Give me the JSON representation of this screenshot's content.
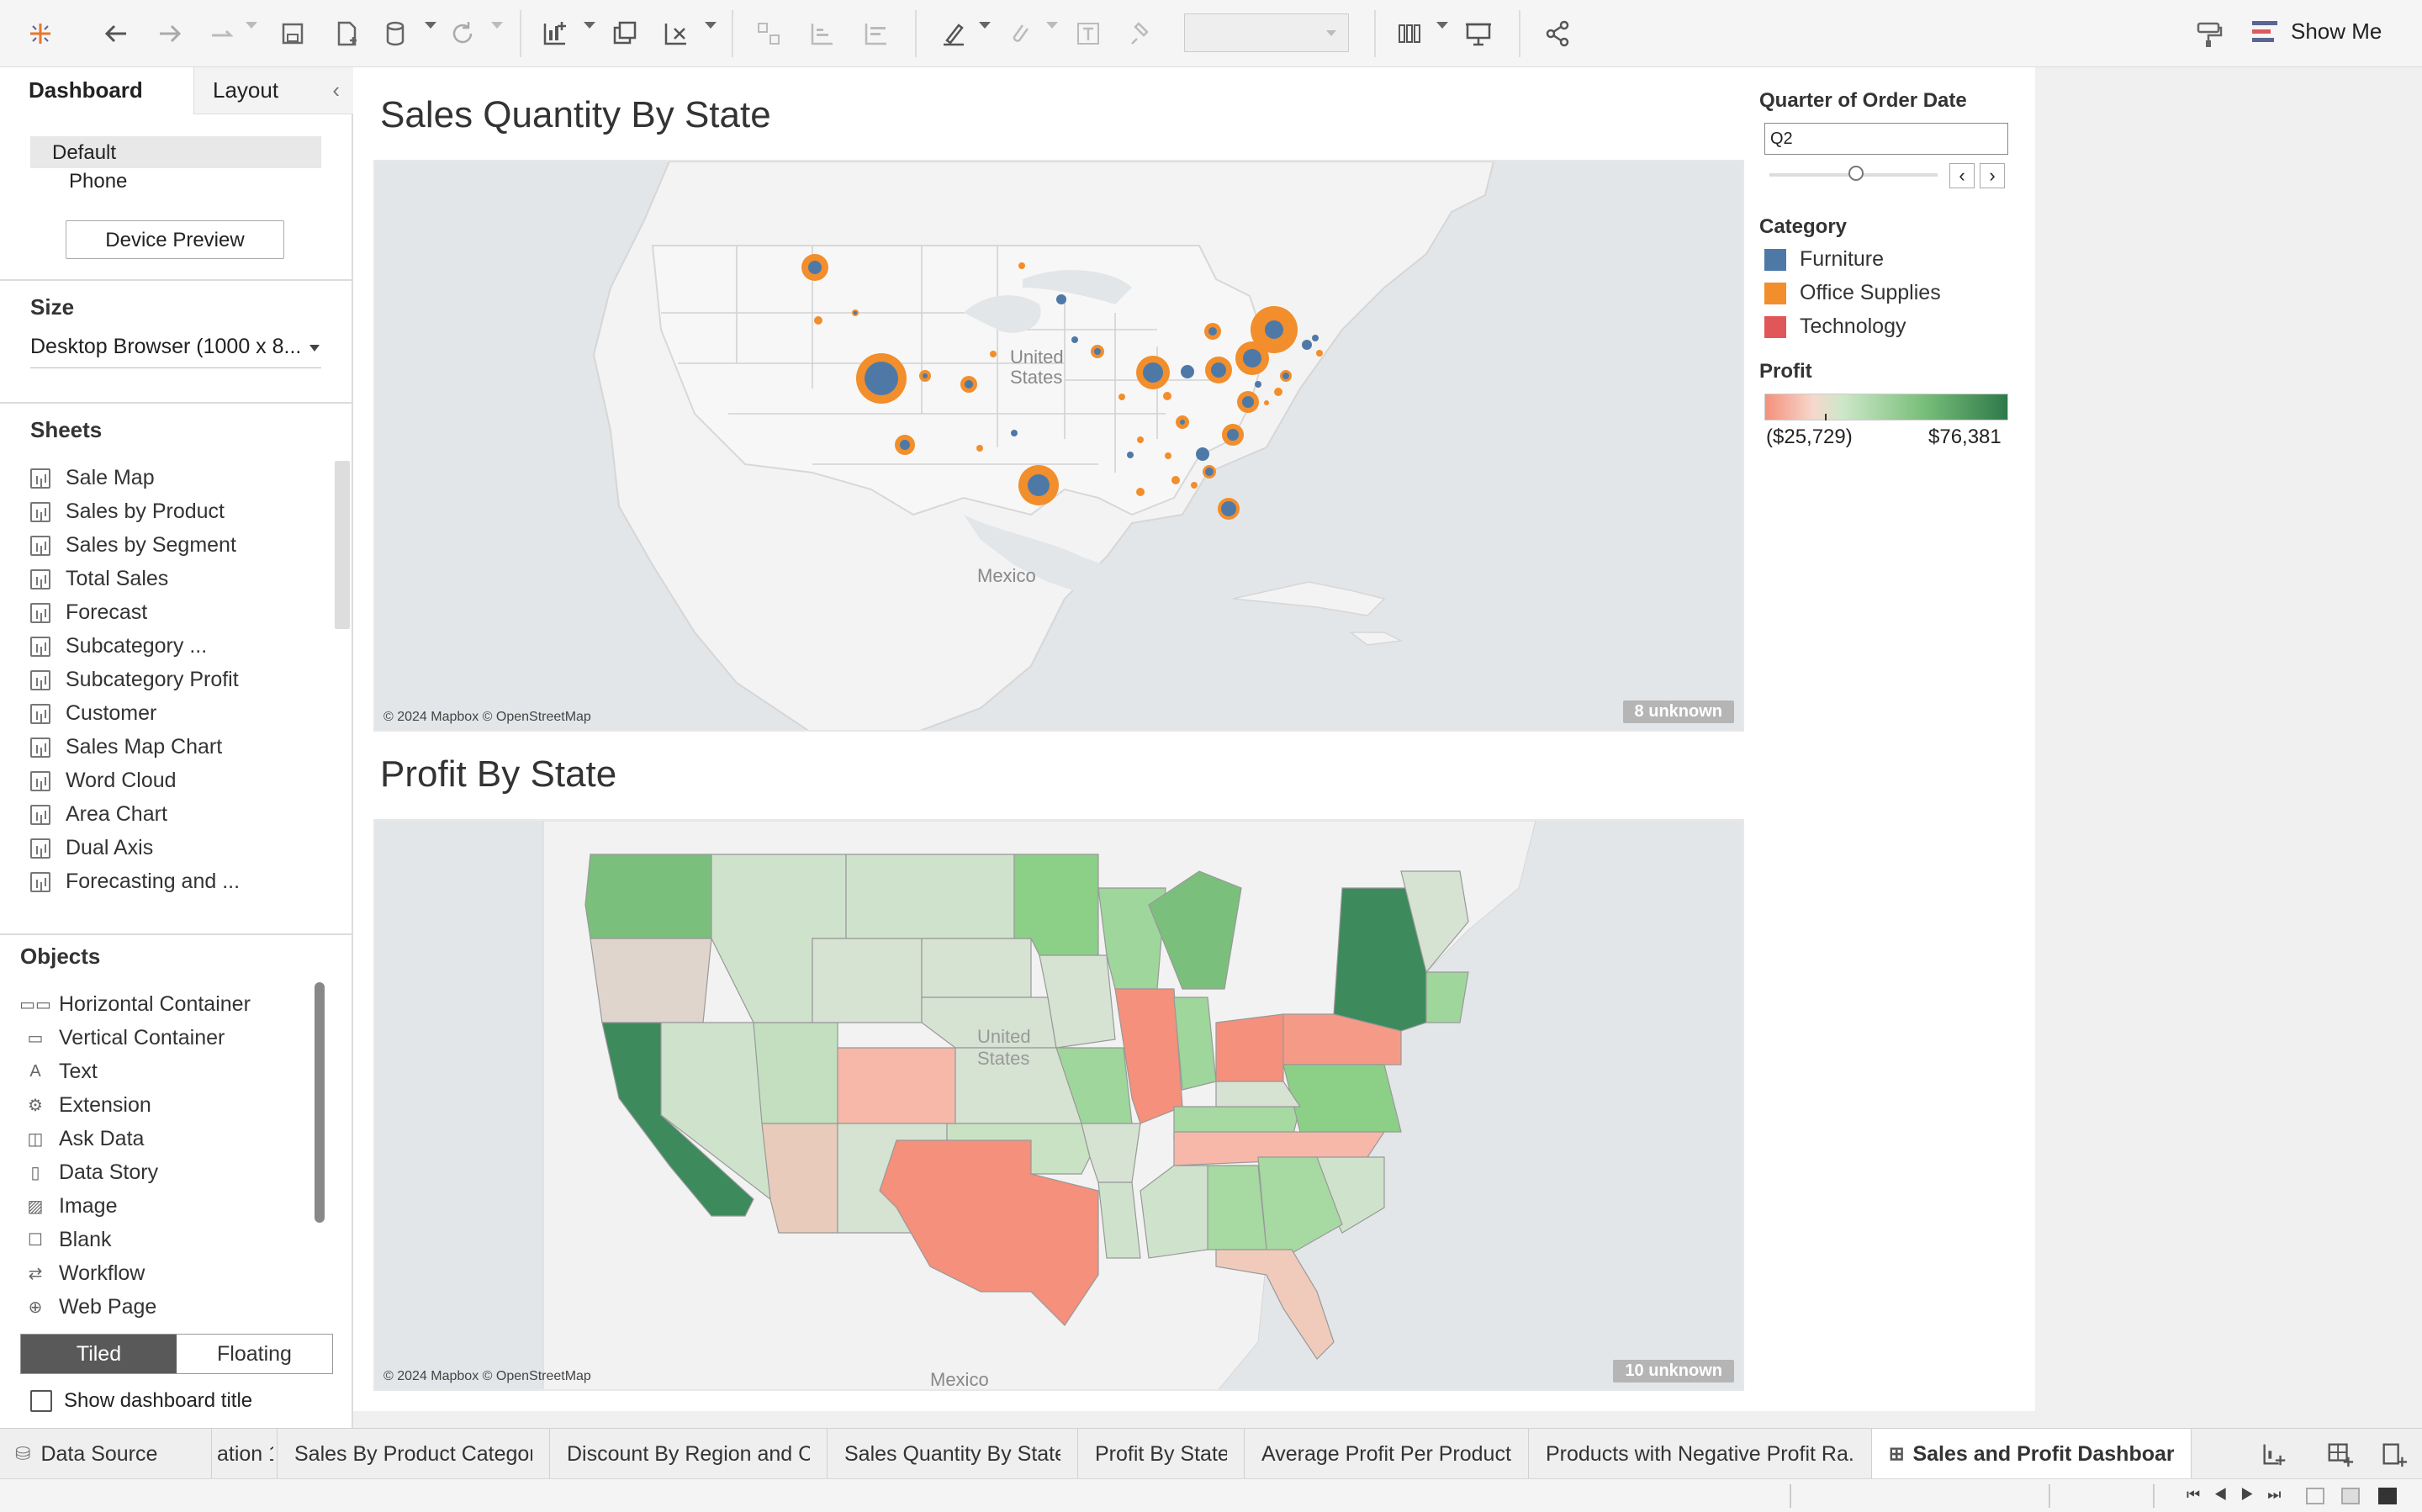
{
  "toolbar": {
    "show_me_label": "Show Me",
    "fit_select": ""
  },
  "left_panel": {
    "tab_dashboard": "Dashboard",
    "tab_layout": "Layout",
    "devices": [
      "Default",
      "Phone"
    ],
    "device_preview_button": "Device Preview",
    "size_header": "Size",
    "size_value": "Desktop Browser (1000 x 8...",
    "sheets_header": "Sheets",
    "sheets": [
      "Sale Map",
      "Sales by Product",
      "Sales by Segment",
      "Total Sales",
      "Forecast",
      "Subcategory ...",
      "Subcategory Profit",
      "Customer",
      "Sales Map Chart",
      "Word Cloud",
      "Area Chart",
      "Dual Axis",
      "Forecasting and ..."
    ],
    "objects_header": "Objects",
    "objects": [
      "Horizontal Container",
      "Vertical Container",
      "Text",
      "Extension",
      "Ask Data",
      "Data Story",
      "Image",
      "Blank",
      "Workflow",
      "Web Page"
    ],
    "tiled_label": "Tiled",
    "floating_label": "Floating",
    "show_title_label": "Show dashboard title"
  },
  "dashboard": {
    "sheet1_title": "Sales Quantity By State",
    "sheet2_title": "Profit By State",
    "map_labels": {
      "united": "United",
      "states": "States",
      "mexico": "Mexico"
    },
    "copyright": "© 2024 Mapbox © OpenStreetMap",
    "sheet1_unknown": "8 unknown",
    "sheet2_unknown": "10 unknown"
  },
  "filters": {
    "quarter_label": "Quarter of Order Date",
    "quarter_value": "Q2",
    "category_label": "Category",
    "categories": [
      {
        "name": "Furniture",
        "color": "#4e79a7"
      },
      {
        "name": "Office Supplies",
        "color": "#f28e2b"
      },
      {
        "name": "Technology",
        "color": "#e15759"
      }
    ],
    "profit_label": "Profit",
    "profit_min": "($25,729)",
    "profit_max": "$76,381"
  },
  "bottom_tabs": {
    "data_source": "Data Source",
    "tabs": [
      "ation 1",
      "Sales By Product Category",
      "Discount By Region and Category",
      "Sales Quantity By State",
      "Profit By State",
      "Average Profit Per Product",
      "Products with Negative Profit Ra...",
      "Sales and Profit Dashboard"
    ],
    "active_tab": "Sales and Profit Dashboard"
  }
}
